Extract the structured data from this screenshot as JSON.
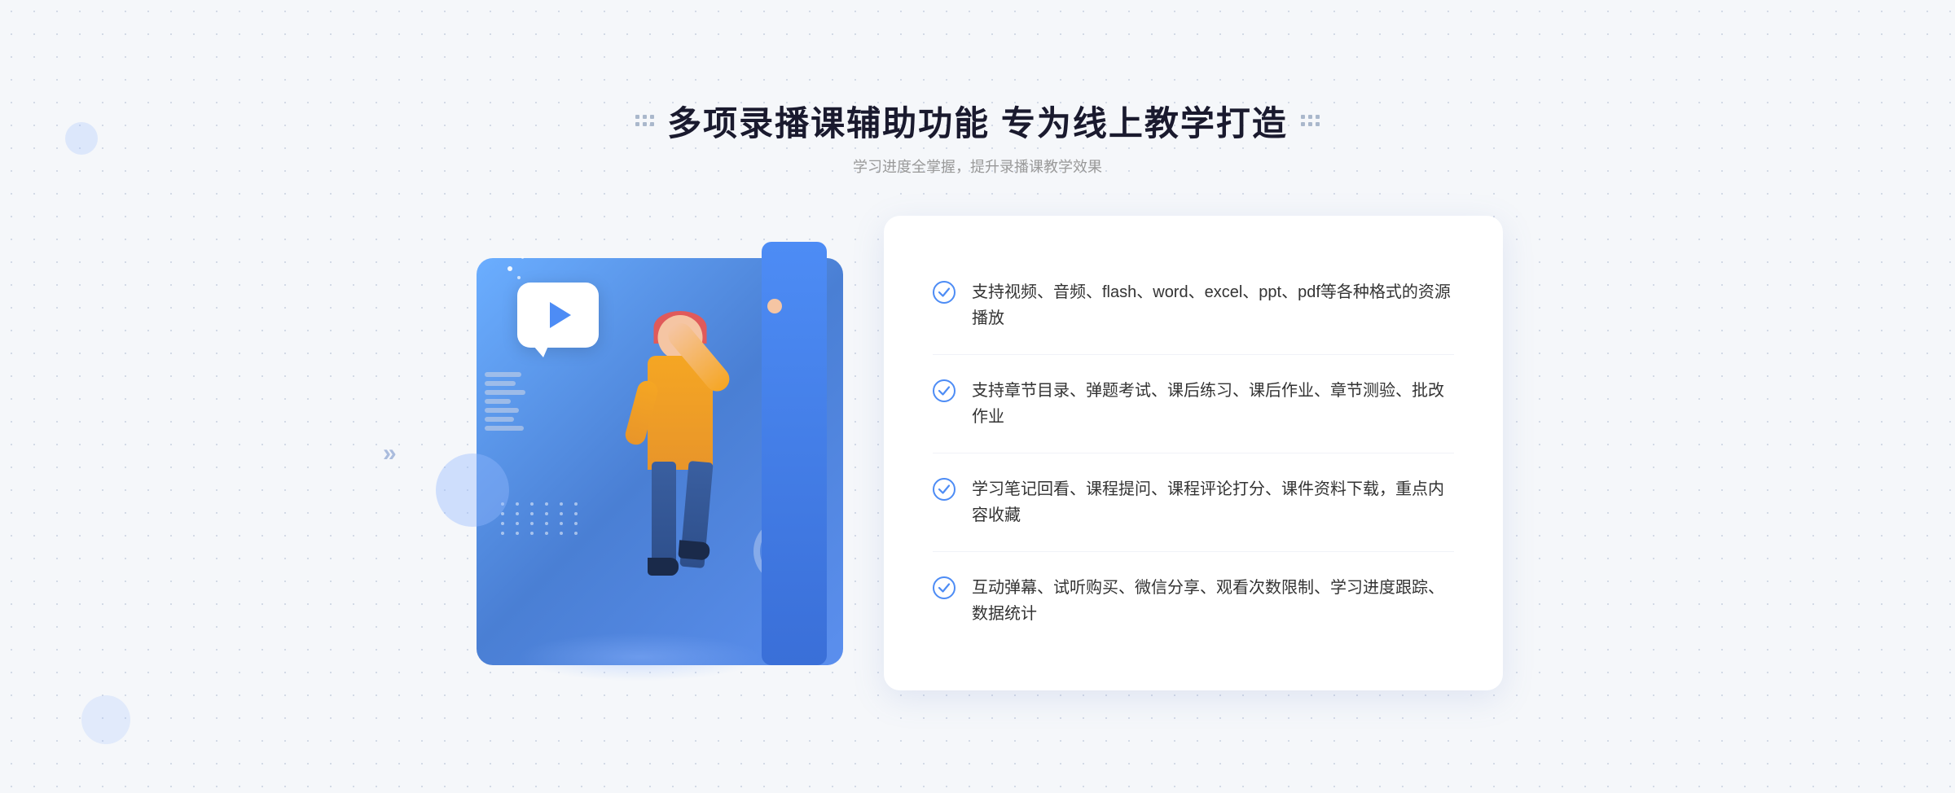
{
  "header": {
    "title": "多项录播课辅助功能 专为线上教学打造",
    "subtitle": "学习进度全掌握，提升录播课教学效果",
    "decorator_left": "⁝⁝",
    "decorator_right": "⁝⁝"
  },
  "features": [
    {
      "id": "feature-1",
      "text": "支持视频、音频、flash、word、excel、ppt、pdf等各种格式的资源播放"
    },
    {
      "id": "feature-2",
      "text": "支持章节目录、弹题考试、课后练习、课后作业、章节测验、批改作业"
    },
    {
      "id": "feature-3",
      "text": "学习笔记回看、课程提问、课程评论打分、课件资料下载，重点内容收藏"
    },
    {
      "id": "feature-4",
      "text": "互动弹幕、试听购买、微信分享、观看次数限制、学习进度跟踪、数据统计"
    }
  ],
  "colors": {
    "primary_blue": "#4a7fd4",
    "light_blue": "#6baeff",
    "check_blue": "#4d8cf5",
    "text_dark": "#1a1a2e",
    "text_gray": "#999999",
    "text_feature": "#333333"
  },
  "arrows_decoration": "»"
}
